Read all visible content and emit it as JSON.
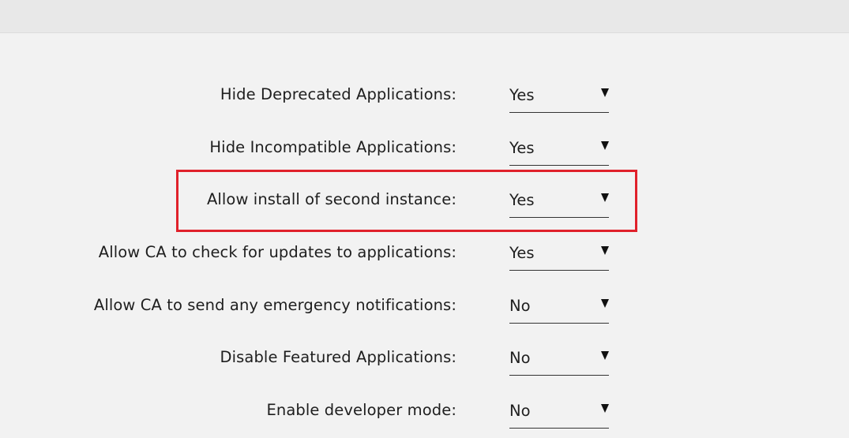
{
  "settings": [
    {
      "label": "Hide Deprecated Applications:",
      "value": "Yes"
    },
    {
      "label": "Hide Incompatible Applications:",
      "value": "Yes"
    },
    {
      "label": "Allow install of second instance:",
      "value": "Yes"
    },
    {
      "label": "Allow CA to check for updates to applications:",
      "value": "Yes"
    },
    {
      "label": "Allow CA to send any emergency notifications:",
      "value": "No"
    },
    {
      "label": "Disable Featured Applications:",
      "value": "No"
    },
    {
      "label": "Enable developer mode:",
      "value": "No"
    }
  ],
  "highlighted_setting_index": 2,
  "colors": {
    "background": "#f2f2f2",
    "topbar": "#e8e8e8",
    "highlight": "#e0212b"
  }
}
